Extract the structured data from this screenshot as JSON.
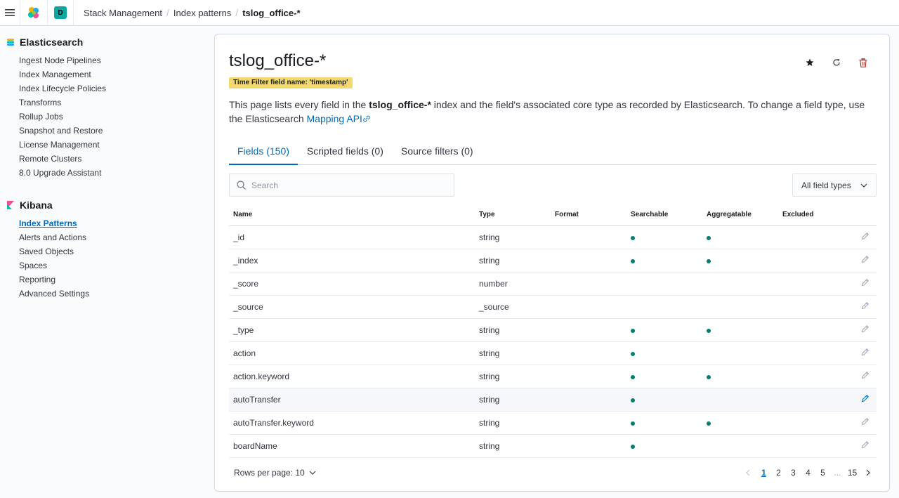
{
  "header": {
    "space_initial": "D",
    "breadcrumbs": [
      "Stack Management",
      "Index patterns",
      "tslog_office-*"
    ]
  },
  "sidebar": {
    "elasticsearch": {
      "title": "Elasticsearch",
      "items": [
        "Ingest Node Pipelines",
        "Index Management",
        "Index Lifecycle Policies",
        "Transforms",
        "Rollup Jobs",
        "Snapshot and Restore",
        "License Management",
        "Remote Clusters",
        "8.0 Upgrade Assistant"
      ]
    },
    "kibana": {
      "title": "Kibana",
      "items": [
        "Index Patterns",
        "Alerts and Actions",
        "Saved Objects",
        "Spaces",
        "Reporting",
        "Advanced Settings"
      ],
      "active": "Index Patterns"
    }
  },
  "page": {
    "title": "tslog_office-*",
    "time_filter_badge": "Time Filter field name: 'timestamp'",
    "description_pre": "This page lists every field in the ",
    "description_index": "tslog_office-*",
    "description_post": " index and the field's associated core type as recorded by Elasticsearch. To change a field type, use the Elasticsearch ",
    "mapping_link": "Mapping API"
  },
  "tabs": [
    {
      "label": "Fields (150)",
      "active": true
    },
    {
      "label": "Scripted fields (0)",
      "active": false
    },
    {
      "label": "Source filters (0)",
      "active": false
    }
  ],
  "search": {
    "placeholder": "Search"
  },
  "filter_select": {
    "value": "All field types"
  },
  "table": {
    "columns": [
      "Name",
      "Type",
      "Format",
      "Searchable",
      "Aggregatable",
      "Excluded"
    ],
    "rows": [
      {
        "name": "_id",
        "type": "string",
        "format": "",
        "searchable": true,
        "aggregatable": true,
        "excluded": false
      },
      {
        "name": "_index",
        "type": "string",
        "format": "",
        "searchable": true,
        "aggregatable": true,
        "excluded": false
      },
      {
        "name": "_score",
        "type": "number",
        "format": "",
        "searchable": false,
        "aggregatable": false,
        "excluded": false
      },
      {
        "name": "_source",
        "type": "_source",
        "format": "",
        "searchable": false,
        "aggregatable": false,
        "excluded": false
      },
      {
        "name": "_type",
        "type": "string",
        "format": "",
        "searchable": true,
        "aggregatable": true,
        "excluded": false
      },
      {
        "name": "action",
        "type": "string",
        "format": "",
        "searchable": true,
        "aggregatable": false,
        "excluded": false
      },
      {
        "name": "action.keyword",
        "type": "string",
        "format": "",
        "searchable": true,
        "aggregatable": true,
        "excluded": false
      },
      {
        "name": "autoTransfer",
        "type": "string",
        "format": "",
        "searchable": true,
        "aggregatable": false,
        "excluded": false,
        "hover": true
      },
      {
        "name": "autoTransfer.keyword",
        "type": "string",
        "format": "",
        "searchable": true,
        "aggregatable": true,
        "excluded": false
      },
      {
        "name": "boardName",
        "type": "string",
        "format": "",
        "searchable": true,
        "aggregatable": false,
        "excluded": false
      }
    ]
  },
  "pagination": {
    "rows_per_page_label": "Rows per page: 10",
    "pages": [
      "1",
      "2",
      "3",
      "4",
      "5",
      "...",
      "15"
    ],
    "current": "1"
  },
  "colors": {
    "accent": "#006bb8",
    "dot": "#017d73",
    "badge": "#f1d86f",
    "delete": "#bd271e"
  }
}
